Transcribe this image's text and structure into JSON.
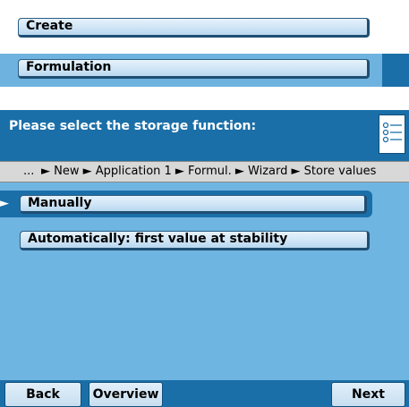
{
  "top_buttons": {
    "create_label": "Create",
    "formulation_label": "Formulation"
  },
  "dialog": {
    "title": "Please select the storage function:",
    "breadcrumb": {
      "ellipsis": "...",
      "path": "► New ► Application 1 ► Formul. ► Wizard ► Store values"
    },
    "options": [
      {
        "label": "Manually",
        "selected": true
      },
      {
        "label": "Automatically: first value at stability",
        "selected": false
      }
    ],
    "selection_marker": "►"
  },
  "softkeys": {
    "back": "Back",
    "overview": "Overview",
    "next": "Next"
  },
  "colors": {
    "header_blue": "#1b6fa8",
    "panel_blue": "#6fb5e1",
    "button_fill": "#cfe5f6",
    "breadcrumb_gray": "#d8d8d8"
  }
}
